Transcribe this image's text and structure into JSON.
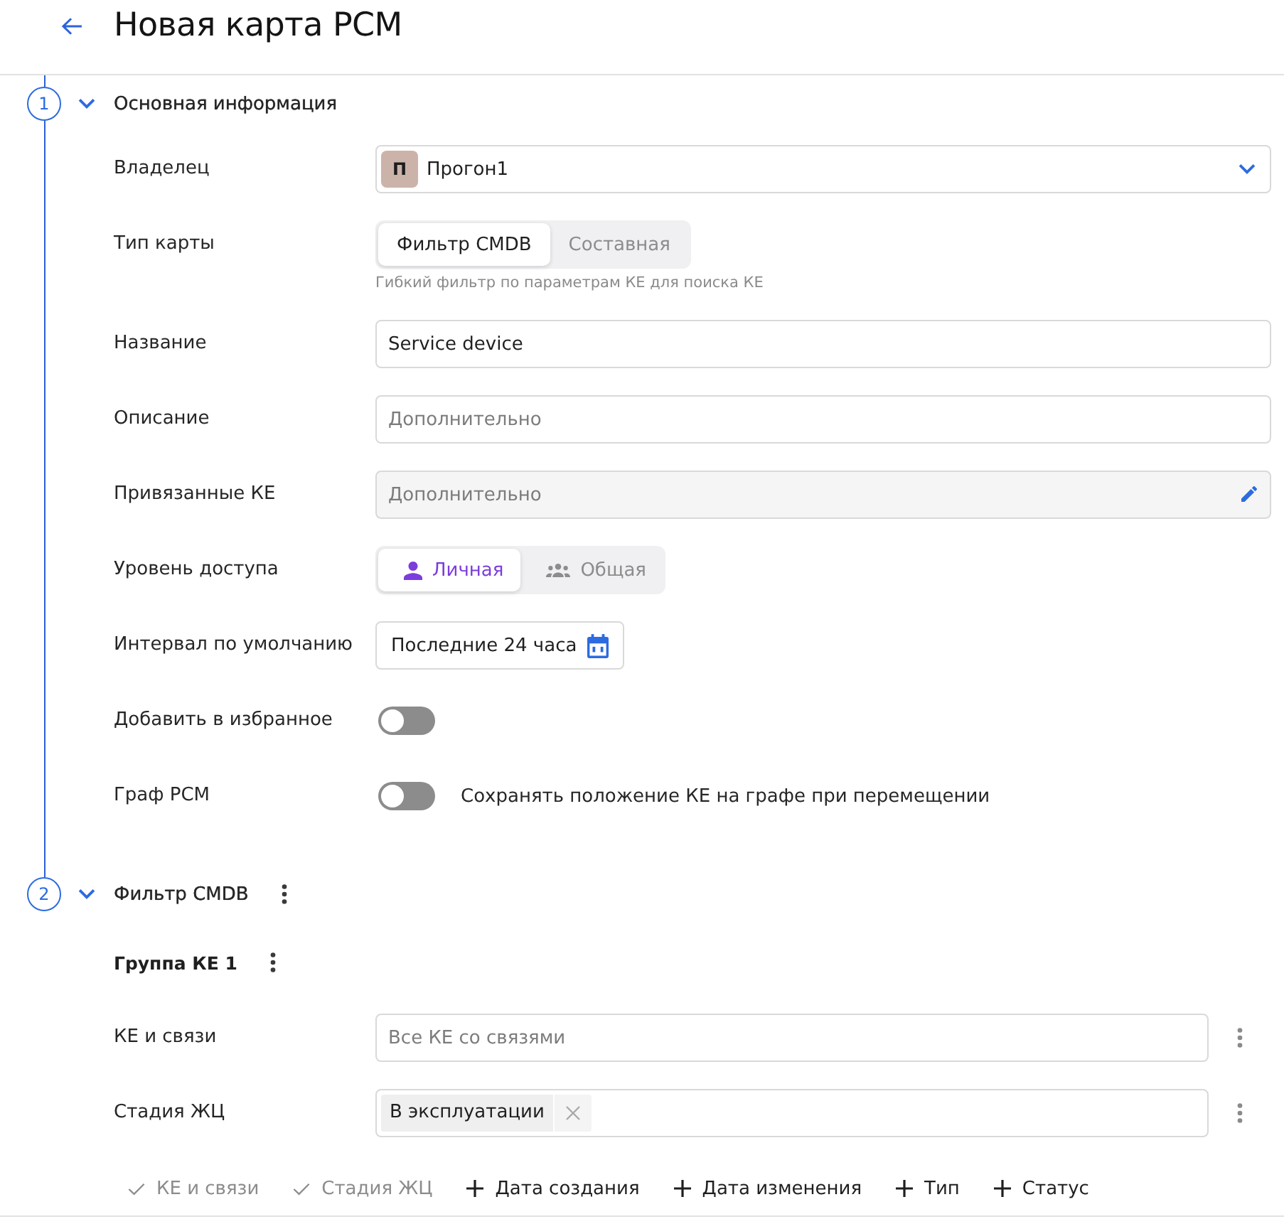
{
  "header": {
    "title": "Новая карта РСМ"
  },
  "sections": [
    {
      "number": "1",
      "expanded": true,
      "title": "Основная информация",
      "fields": [
        {
          "kind": "select",
          "label": "Владелец",
          "avatar": "П",
          "value": "Прогон1"
        },
        {
          "kind": "segmented",
          "label": "Тип карты",
          "options": [
            {
              "label": "Фильтр CMDB",
              "selected": true
            },
            {
              "label": "Составная",
              "selected": false
            }
          ],
          "hint": "Гибкий фильтр по параметрам КЕ для поиска КЕ"
        },
        {
          "kind": "input",
          "label": "Название",
          "value": "Service device"
        },
        {
          "kind": "input",
          "label": "Описание",
          "placeholder": "Дополнительно"
        },
        {
          "kind": "picker",
          "label": "Привязанные КЕ",
          "placeholder": "Дополнительно"
        },
        {
          "kind": "access",
          "label": "Уровень доступа",
          "options": [
            {
              "label": "Личная",
              "selected": true
            },
            {
              "label": "Общая",
              "selected": false
            }
          ]
        },
        {
          "kind": "interval",
          "label": "Интервал по умолчанию",
          "value": "Последние 24 часа"
        },
        {
          "kind": "toggle",
          "label": "Добавить в избранное",
          "on": false
        },
        {
          "kind": "toggle",
          "label": "Граф РСМ",
          "on": false,
          "caption": "Сохранять положение КЕ на графе при перемещении"
        }
      ]
    },
    {
      "number": "2",
      "expanded": true,
      "menu": true,
      "title": "Фильтр CMDB",
      "groups": [
        {
          "title": "Группа КЕ 1",
          "menu": true,
          "filters": [
            {
              "kind": "input",
              "label": "КЕ и связи",
              "placeholder": "Все КЕ со связями"
            },
            {
              "kind": "chips",
              "label": "Стадия ЖЦ",
              "chips": [
                "В эксплуатации"
              ]
            }
          ],
          "add_filters": [
            {
              "label": "КЕ и связи",
              "added": true
            },
            {
              "label": "Стадия ЖЦ",
              "added": true
            },
            {
              "label": "Дата создания",
              "added": false
            },
            {
              "label": "Дата изменения",
              "added": false
            },
            {
              "label": "Тип",
              "added": false
            },
            {
              "label": "Статус",
              "added": false
            }
          ]
        }
      ]
    }
  ]
}
